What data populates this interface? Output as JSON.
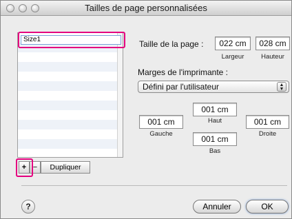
{
  "window": {
    "title": "Tailles de page personnalisées"
  },
  "sizes_list": {
    "selected_name": "Size1"
  },
  "list_controls": {
    "add_label": "+",
    "remove_label": "−",
    "duplicate_label": "Dupliquer"
  },
  "page_size": {
    "label": "Taille de la page :",
    "width_value": "022 cm",
    "width_label": "Largeur",
    "height_value": "028 cm",
    "height_label": "Hauteur"
  },
  "margins": {
    "label": "Marges de l'imprimante :",
    "preset": "Défini par l'utilisateur",
    "top_value": "001 cm",
    "top_label": "Haut",
    "left_value": "001 cm",
    "left_label": "Gauche",
    "right_value": "001 cm",
    "right_label": "Droite",
    "bottom_value": "001 cm",
    "bottom_label": "Bas"
  },
  "footer": {
    "help_label": "?",
    "cancel_label": "Annuler",
    "ok_label": "OK"
  },
  "colors": {
    "highlight": "#e4007f",
    "default_button_glow": "#7aa0d8"
  }
}
